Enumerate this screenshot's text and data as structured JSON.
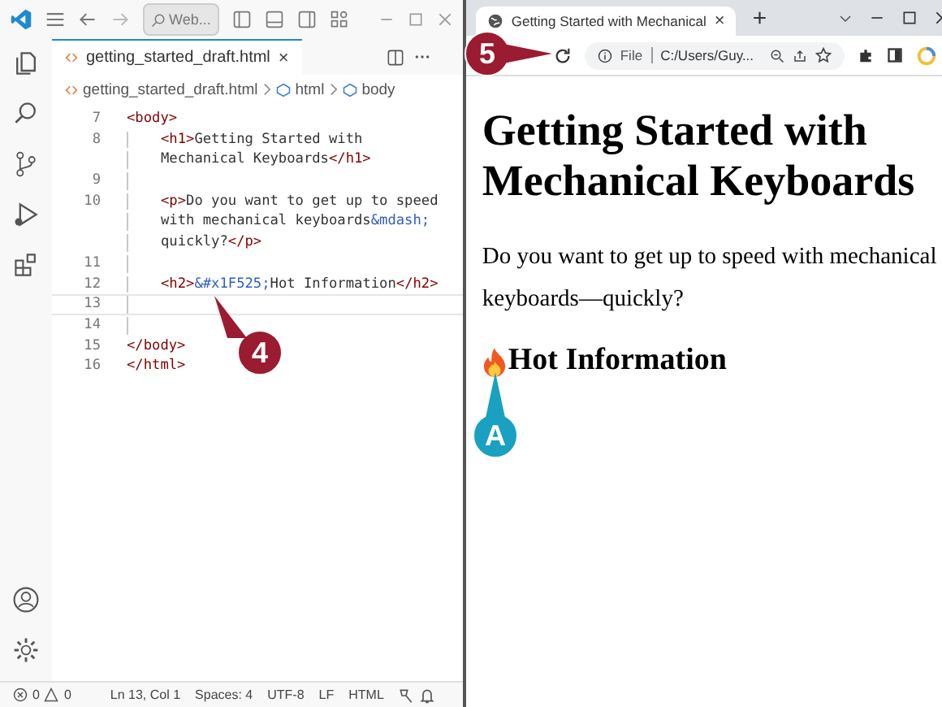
{
  "editor": {
    "search": {
      "placeholder": "Web..."
    },
    "tab": {
      "label": "getting_started_draft.html",
      "close": "×",
      "selected": true
    },
    "breadcrumb": [
      "getting_started_draft.html",
      "html",
      "body"
    ],
    "code": [
      {
        "number": "7",
        "current": false,
        "segments": [
          {
            "kind": "tag",
            "text": "<body>"
          }
        ],
        "nested": false
      },
      {
        "number": "8",
        "current": false,
        "segments": [
          {
            "kind": "tag",
            "text": "<h1>"
          },
          {
            "kind": "text",
            "text": "Getting Started with"
          }
        ],
        "nested": true
      },
      {
        "current": false,
        "segments": [
          {
            "kind": "text",
            "text": "Mechanical Keyboards"
          },
          {
            "kind": "tag",
            "text": "</h1>"
          }
        ],
        "nested": true
      },
      {
        "number": "9",
        "current": false,
        "nested": true
      },
      {
        "number": "10",
        "current": false,
        "segments": [
          {
            "kind": "tag",
            "text": "<p>"
          },
          {
            "kind": "text",
            "text": "Do you want to get up to speed"
          }
        ],
        "nested": true
      },
      {
        "current": false,
        "segments": [
          {
            "kind": "text",
            "text": "with mechanical keyboards"
          },
          {
            "kind": "entity",
            "text": "&mdash;"
          }
        ],
        "nested": true
      },
      {
        "current": false,
        "segments": [
          {
            "kind": "text",
            "text": "quickly?"
          },
          {
            "kind": "tag",
            "text": "</p>"
          }
        ],
        "nested": true
      },
      {
        "number": "11",
        "current": false,
        "nested": true
      },
      {
        "number": "12",
        "current": false,
        "segments": [
          {
            "kind": "tag",
            "text": "<h2>"
          },
          {
            "kind": "entity",
            "text": "&#x1F525;"
          },
          {
            "kind": "text",
            "text": "Hot Information"
          },
          {
            "kind": "tag",
            "text": "</h2>"
          }
        ],
        "nested": true
      },
      {
        "number": "13",
        "current": true,
        "nested": true
      },
      {
        "number": "14",
        "current": false,
        "nested": true
      },
      {
        "number": "15",
        "current": false,
        "segments": [
          {
            "kind": "tag",
            "text": "</body>"
          }
        ],
        "nested": false
      },
      {
        "number": "16",
        "current": false,
        "segments": [
          {
            "kind": "tag",
            "text": "</html>"
          }
        ],
        "nested": false
      }
    ],
    "status": {
      "errors": "0",
      "warnings": "0",
      "items": [
        "Ln 13, Col 1",
        "Spaces: 4",
        "UTF-8",
        "LF",
        "HTML"
      ]
    }
  },
  "browser": {
    "tab": {
      "title": "Getting Started with Mechanical",
      "close": "×",
      "selected": true
    },
    "new_tab": "+",
    "address": {
      "scheme": "File",
      "url": "C:/Users/Guy..."
    },
    "page": {
      "h1": "Getting Started with Mechanical Keyboards",
      "paragraph": "Do you want to get up to speed with mechanical keyboards—quickly?",
      "h2": "Hot Information"
    }
  },
  "callouts": [
    {
      "label": "5",
      "color": "#9b1b30"
    },
    {
      "label": "4",
      "color": "#9b1b30"
    },
    {
      "label": "A",
      "color": "#1aa0c0"
    }
  ]
}
